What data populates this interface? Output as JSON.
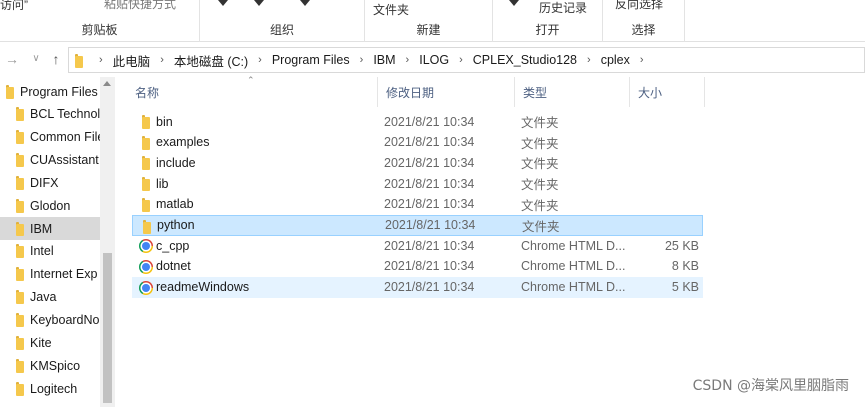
{
  "ribbon": {
    "access_text": "访问”",
    "paste_shortcut": "粘贴快捷方式",
    "new_item": "文件夹",
    "history": "历史记录",
    "invert_selection": "反向选择",
    "groups": {
      "clipboard": "剪贴板",
      "organize": "组织",
      "new": "新建",
      "open": "打开",
      "select": "选择"
    }
  },
  "nav": {
    "back_icon": "arrow-left",
    "forward_icon": "arrow-right",
    "recent_icon": "chevron-down",
    "up_icon": "arrow-up",
    "breadcrumbs": [
      "此电脑",
      "本地磁盘 (C:)",
      "Program Files",
      "IBM",
      "ILOG",
      "CPLEX_Studio128",
      "cplex"
    ]
  },
  "tree": {
    "items": [
      {
        "label": "Program Files"
      },
      {
        "label": "BCL Technol"
      },
      {
        "label": "Common File"
      },
      {
        "label": "CUAssistant"
      },
      {
        "label": "DIFX"
      },
      {
        "label": "Glodon"
      },
      {
        "label": "IBM"
      },
      {
        "label": "Intel"
      },
      {
        "label": "Internet Exp"
      },
      {
        "label": "Java"
      },
      {
        "label": "KeyboardNo"
      },
      {
        "label": "Kite"
      },
      {
        "label": "KMSpico"
      },
      {
        "label": "Logitech"
      }
    ],
    "selected_index": 6
  },
  "columns": {
    "name": "名称",
    "date": "修改日期",
    "type": "类型",
    "size": "大小"
  },
  "files": [
    {
      "name": "bin",
      "date": "2021/8/21 10:34",
      "type": "文件夹",
      "size": "",
      "icon": "folder-icon"
    },
    {
      "name": "examples",
      "date": "2021/8/21 10:34",
      "type": "文件夹",
      "size": "",
      "icon": "folder-icon"
    },
    {
      "name": "include",
      "date": "2021/8/21 10:34",
      "type": "文件夹",
      "size": "",
      "icon": "folder-icon"
    },
    {
      "name": "lib",
      "date": "2021/8/21 10:34",
      "type": "文件夹",
      "size": "",
      "icon": "folder-icon"
    },
    {
      "name": "matlab",
      "date": "2021/8/21 10:34",
      "type": "文件夹",
      "size": "",
      "icon": "folder-icon"
    },
    {
      "name": "python",
      "date": "2021/8/21 10:34",
      "type": "文件夹",
      "size": "",
      "icon": "folder-icon"
    },
    {
      "name": "c_cpp",
      "date": "2021/8/21 10:34",
      "type": "Chrome HTML D...",
      "size": "25 KB",
      "icon": "chrome-icon"
    },
    {
      "name": "dotnet",
      "date": "2021/8/21 10:34",
      "type": "Chrome HTML D...",
      "size": "8 KB",
      "icon": "chrome-icon"
    },
    {
      "name": "readmeWindows",
      "date": "2021/8/21 10:34",
      "type": "Chrome HTML D...",
      "size": "5 KB",
      "icon": "chrome-icon"
    }
  ],
  "selected_file": "python",
  "hovered_file": "readmeWindows",
  "watermark": "CSDN @海棠风里胭脂雨",
  "colors": {
    "selection_bg": "#cce8ff",
    "selection_border": "#99d1ff",
    "hover_bg": "#e5f3ff",
    "header_text": "#4d6082",
    "folder_yellow": "#f5c84c"
  }
}
